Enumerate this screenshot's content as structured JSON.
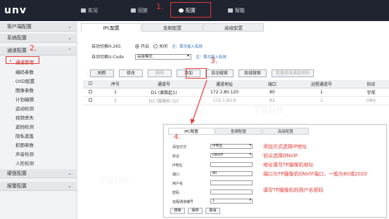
{
  "header": {
    "logo": "unv",
    "nav": [
      {
        "label": "实况",
        "icon": "monitor-icon"
      },
      {
        "label": "回放",
        "icon": "playback-icon"
      },
      {
        "label": "配置",
        "icon": "gear-icon",
        "active": true
      },
      {
        "label": "智能",
        "icon": "person-icon"
      }
    ]
  },
  "annotations": {
    "step1": "1.",
    "step2": "2.",
    "step3": "3.",
    "step4": "4."
  },
  "sidebar": {
    "sections": [
      {
        "label": "客户端配置"
      },
      {
        "label": "系统配置"
      },
      {
        "label": "通道配置"
      },
      {
        "label": "硬盘配置"
      },
      {
        "label": "报警配置"
      }
    ],
    "items": [
      "通道管理",
      "编码参数",
      "OSD配置",
      "图像参数",
      "计划编辑",
      "运动检测",
      "视频丢失",
      "遮挡检测",
      "隐私遮盖",
      "抓图参数",
      "声音检测",
      "人形检测"
    ]
  },
  "tabs": [
    "IPC配置",
    "鱼眼配置",
    "高级配置"
  ],
  "form": {
    "h265_label": "自动切换H.265",
    "h265_on": "开启",
    "h265_off": "关闭",
    "h265_note_prefix": "注：",
    "h265_note_link": "首次接入有效",
    "ucode_label": "自动切换U-Code",
    "ucode_value": "高级模式",
    "ucode_note_prefix": "注：",
    "ucode_note_link": "首次接入有效"
  },
  "toolbar": {
    "refresh": "刷新",
    "modify": "修改",
    "delete": "删除",
    "add": "添加",
    "auto_search": "自动搜索",
    "lan_search": "局域搜索",
    "batch_password": "批量修改通道密码"
  },
  "table": {
    "headers": [
      "",
      "序号",
      "通道号",
      "通道地址",
      "端口",
      "远程通道号",
      "协议"
    ],
    "rows": [
      [
        "",
        "1",
        "D1 (黄数起1)",
        "172.1.80.120",
        "80",
        "1",
        "宇视"
      ],
      [
        "",
        "2",
        "D2 (摄像机 02)",
        "172.1.83.9",
        "82",
        "1",
        "ONV"
      ]
    ]
  },
  "dialog": {
    "tabs": [
      "IPC配置",
      "鱼眼配置",
      "高级配置"
    ],
    "fields": [
      {
        "label": "添加方式",
        "value": "IP地址",
        "select": true,
        "note": "添加方式选择IP地址"
      },
      {
        "label": "协议",
        "value": "ONVIF",
        "select": true,
        "note": "协议选择ONVIF"
      },
      {
        "label": "IP地址",
        "value": "",
        "select": false,
        "note": "地址填写TP摄像机地址"
      },
      {
        "label": "端口",
        "value": "80",
        "select": false,
        "note": "端口为TP摄像机ONVIF端口，一般为80或2020"
      },
      {
        "label": "用户名",
        "value": "",
        "select": false,
        "note": ""
      },
      {
        "label": "密码",
        "value": "",
        "select": false,
        "note": "填写TP摄像机的用户名密码"
      },
      {
        "label": "远程通道编号",
        "value": "1",
        "select": true,
        "note": ""
      }
    ],
    "buttons": [
      "搜索",
      "保存",
      "取消"
    ]
  },
  "watermark": "宇视科技"
}
